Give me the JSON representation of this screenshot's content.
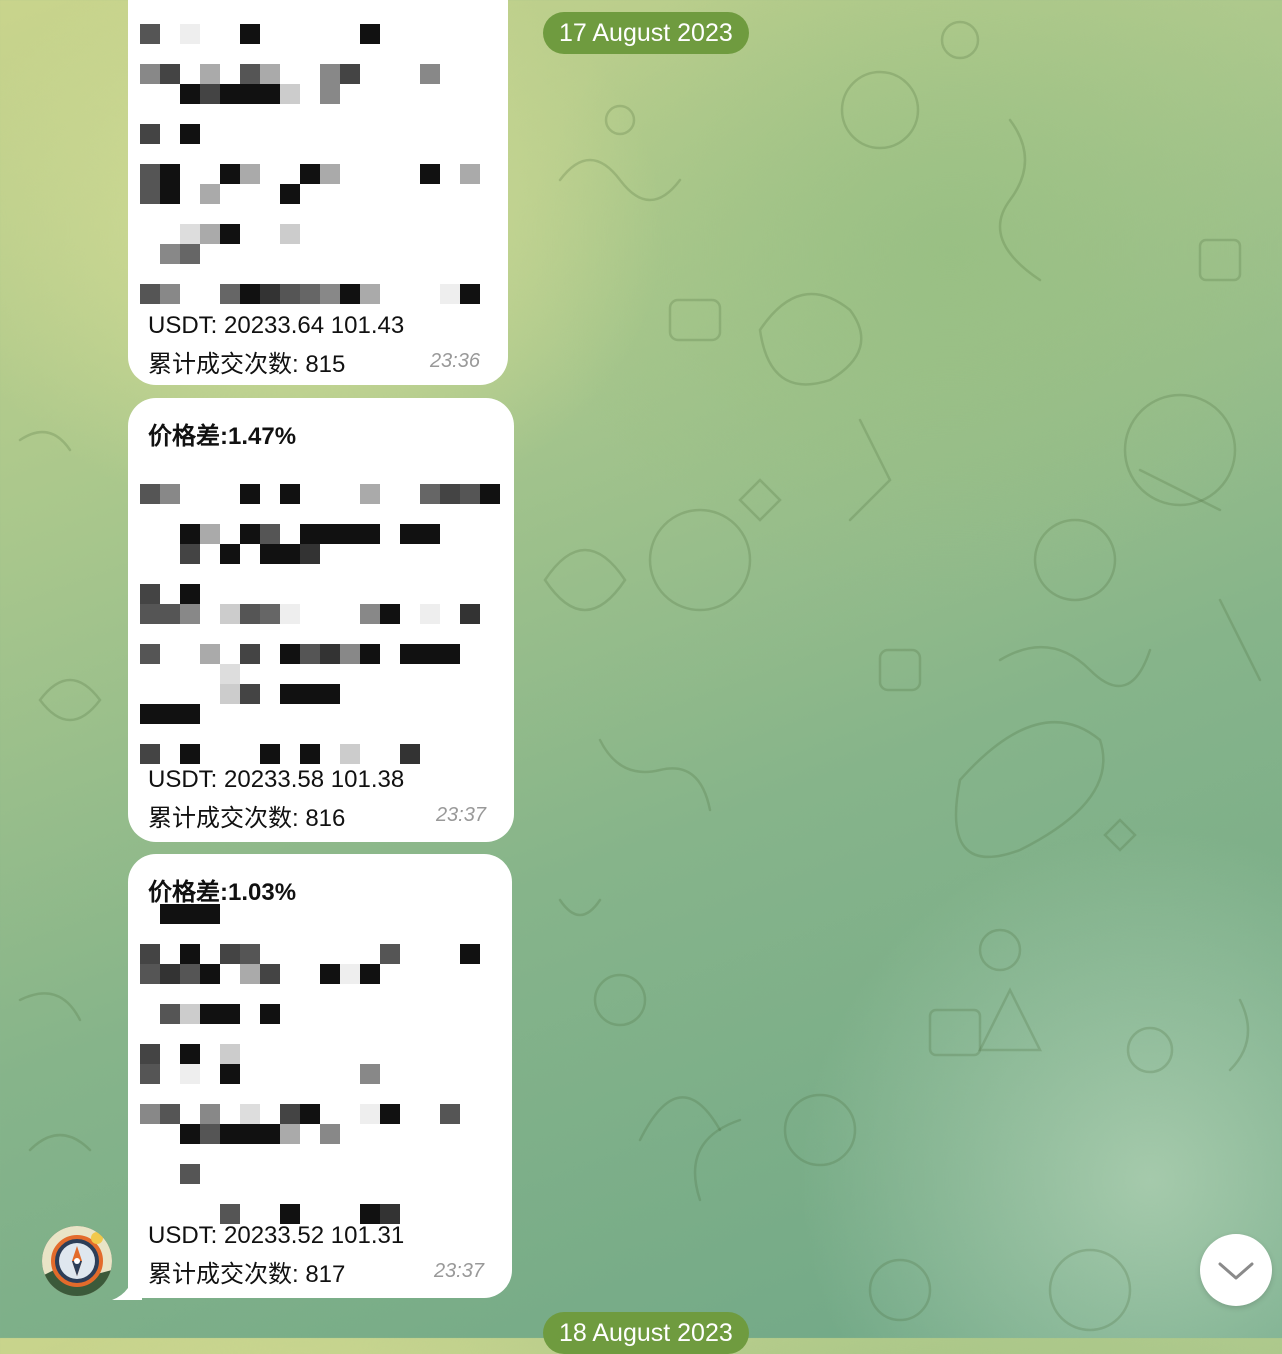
{
  "dates": {
    "top": "17 August 2023",
    "bottom": "18 August 2023"
  },
  "messages": [
    {
      "header": "",
      "line1": "USDT: 20233.64 101.43",
      "line2": "累计成交次数: 815",
      "time": "23:36"
    },
    {
      "header": "价格差:1.47%",
      "line1": "USDT: 20233.58 101.38",
      "line2": "累计成交次数: 816",
      "time": "23:37"
    },
    {
      "header": "价格差:1.03%",
      "line1": "USDT: 20233.52 101.31",
      "line2": "累计成交次数: 817",
      "time": "23:37"
    }
  ],
  "colors": {
    "date_pill": "#6f9b3f",
    "bubble": "#ffffff",
    "timestamp": "#999999"
  },
  "icons": {
    "avatar": "compass-icon",
    "scroll_down": "chevron-down-icon"
  }
}
